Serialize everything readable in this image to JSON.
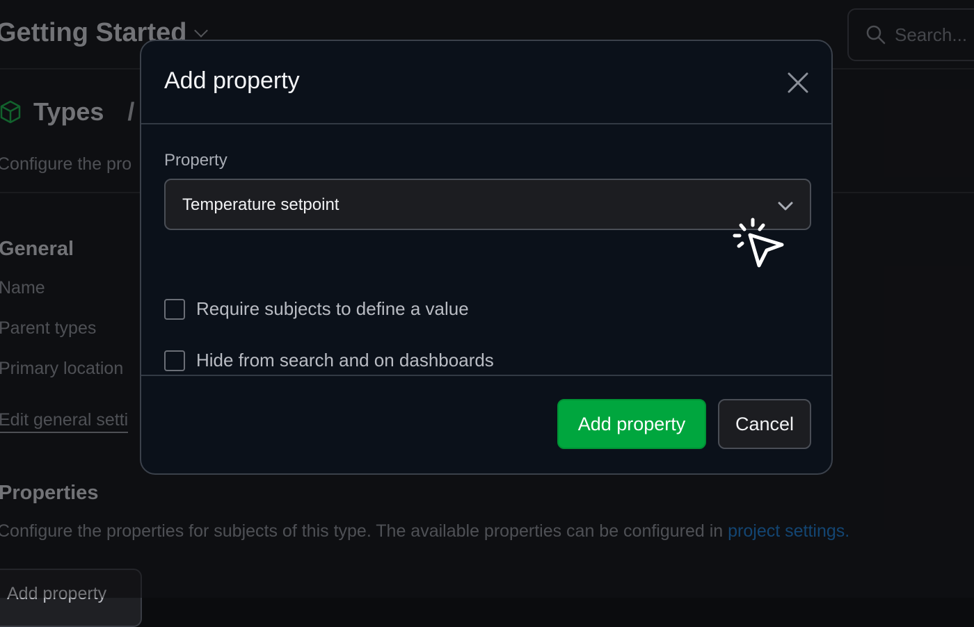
{
  "background": {
    "project_title": "Getting Started",
    "search": {
      "placeholder": "Search..."
    },
    "breadcrumb": {
      "section": "Types",
      "separator": "/"
    },
    "description": "Configure the pro",
    "general": {
      "heading": "General",
      "fields": [
        "Name",
        "Parent types",
        "Primary location"
      ],
      "edit_link": "Edit general setti"
    },
    "properties": {
      "heading": "Properties",
      "description": "Configure the properties for subjects of this type. The available properties can be configured in ",
      "link_text": "project settings.",
      "add_button": "Add property"
    }
  },
  "modal": {
    "title": "Add property",
    "property_label": "Property",
    "property_value": "Temperature setpoint",
    "options": [
      {
        "label": "Require subjects to define a value",
        "checked": false
      },
      {
        "label": "Hide from search and on dashboards",
        "checked": false
      }
    ],
    "primary_button": "Add property",
    "cancel_button": "Cancel"
  },
  "colors": {
    "primary": "#00a63e",
    "modal_bg": "#0b111a",
    "link": "#1f70b8",
    "types_icon": "#1e9e4a"
  },
  "icons": [
    "chevron-down-icon",
    "search-icon",
    "cube-icon",
    "close-icon",
    "click-cursor-icon"
  ]
}
